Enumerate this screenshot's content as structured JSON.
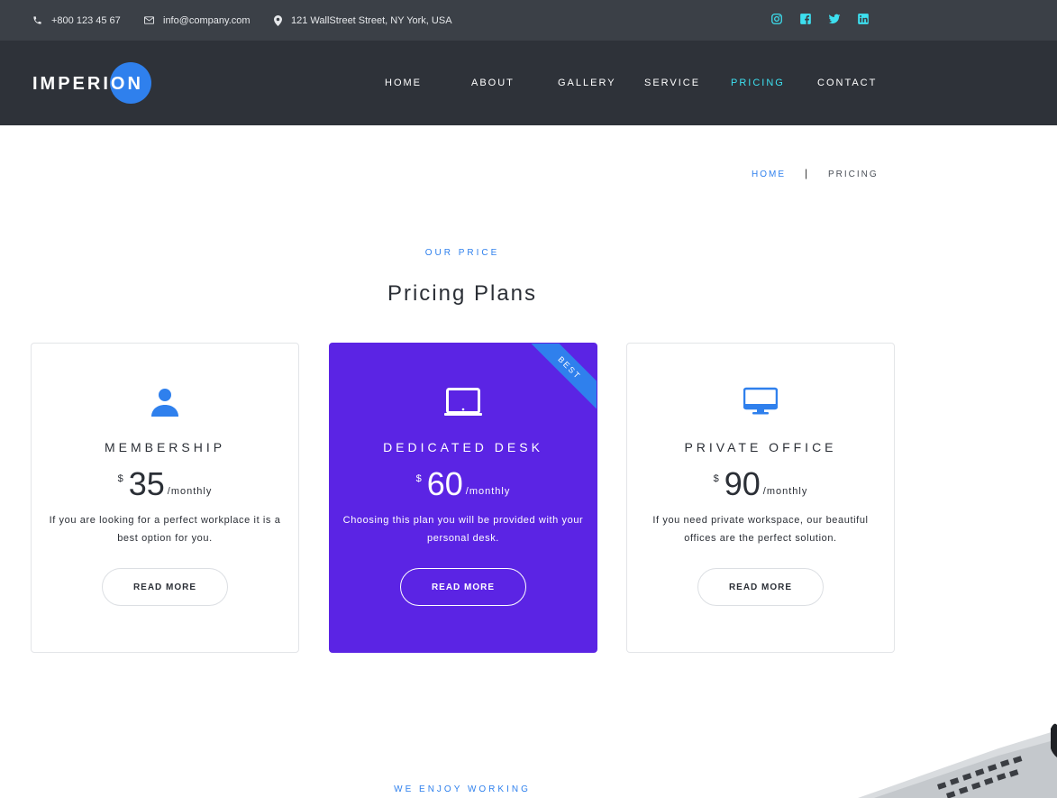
{
  "topbar": {
    "phone": "+800 123 45 67",
    "email": "info@company.com",
    "address": "121 WallStreet Street, NY York, USA",
    "social": [
      "instagram-icon",
      "facebook-icon",
      "twitter-icon",
      "linkedin-icon"
    ],
    "social_color": "#3de0f0"
  },
  "brand": {
    "logo": "IMPERION",
    "accent": "#2f80ed"
  },
  "nav": {
    "items": [
      "HOME",
      "ABOUT",
      "GALLERY",
      "SERVICE",
      "PRICING",
      "CONTACT"
    ],
    "active": "PRICING"
  },
  "breadcrumb": {
    "home": "HOME",
    "separator": "|",
    "current": "PRICING"
  },
  "section": {
    "eyebrow": "OUR PRICE",
    "title": "Pricing Plans"
  },
  "plans": [
    {
      "icon": "user-icon",
      "name": "MEMBERSHIP",
      "currency": "$",
      "price": "35",
      "period": "/monthly",
      "description": "If you are looking for a perfect workplace it is a best option for you.",
      "button": "READ MORE"
    },
    {
      "icon": "tablet-icon",
      "name": "DEDICATED DESK",
      "currency": "$",
      "price": "60",
      "period": "/monthly",
      "description": "Choosing this plan you will be provided with your personal desk.",
      "button": "READ MORE",
      "ribbon": "BEST",
      "featured": true
    },
    {
      "icon": "monitor-icon",
      "name": "PRIVATE OFFICE",
      "currency": "$",
      "price": "90",
      "period": "/monthly",
      "description": "If you need private workspace, our beautiful offices are the perfect solution.",
      "button": "READ MORE"
    }
  ],
  "next_section": {
    "eyebrow": "WE ENJOY WORKING"
  },
  "colors": {
    "featured_bg": "#5b24e4",
    "topbar_bg": "#3b4047",
    "nav_bg": "#2e3239"
  }
}
